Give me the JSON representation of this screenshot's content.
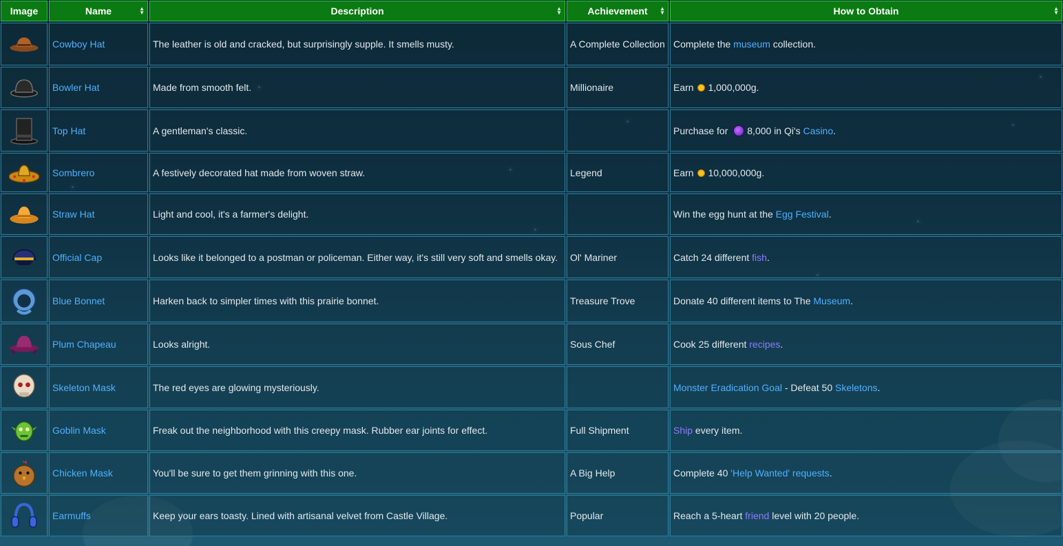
{
  "headers": {
    "image": "Image",
    "name": "Name",
    "description": "Description",
    "achievement": "Achievement",
    "obtain": "How to Obtain"
  },
  "rows": [
    {
      "icon": "cowboy-hat-icon",
      "name": "Cowboy Hat",
      "description": "The leather is old and cracked, but surprisingly supple. It smells musty.",
      "achievement": "A Complete Collection",
      "obtain": [
        {
          "t": "Complete the "
        },
        {
          "link": "museum"
        },
        {
          "t": " collection."
        }
      ]
    },
    {
      "icon": "bowler-hat-icon",
      "name": "Bowler Hat",
      "description": "Made from smooth felt.",
      "achievement": "Millionaire",
      "obtain": [
        {
          "t": "Earn "
        },
        {
          "coin": "gold"
        },
        {
          "t": "1,000,000g."
        }
      ]
    },
    {
      "icon": "top-hat-icon",
      "name": "Top Hat",
      "description": "A gentleman's classic.",
      "achievement": "",
      "obtain": [
        {
          "t": "Purchase for "
        },
        {
          "coin": "qi"
        },
        {
          "t": "8,000 in Qi's "
        },
        {
          "link": "Casino"
        },
        {
          "t": "."
        }
      ]
    },
    {
      "icon": "sombrero-icon",
      "name": "Sombrero",
      "description": "A festively decorated hat made from woven straw.",
      "achievement": "Legend",
      "obtain": [
        {
          "t": "Earn "
        },
        {
          "coin": "gold"
        },
        {
          "t": "10,000,000g."
        }
      ]
    },
    {
      "icon": "straw-hat-icon",
      "name": "Straw Hat",
      "description": "Light and cool, it's a farmer's delight.",
      "achievement": "",
      "obtain": [
        {
          "t": "Win the egg hunt at the "
        },
        {
          "link": "Egg Festival"
        },
        {
          "t": "."
        }
      ]
    },
    {
      "icon": "official-cap-icon",
      "name": "Official Cap",
      "description": "Looks like it belonged to a postman or policeman. Either way, it's still very soft and smells okay.",
      "achievement": "Ol' Mariner",
      "obtain": [
        {
          "t": "Catch 24 different "
        },
        {
          "link": "fish",
          "visited": true
        },
        {
          "t": "."
        }
      ]
    },
    {
      "icon": "blue-bonnet-icon",
      "name": "Blue Bonnet",
      "description": "Harken back to simpler times with this prairie bonnet.",
      "achievement": "Treasure Trove",
      "obtain": [
        {
          "t": "Donate 40 different items to The "
        },
        {
          "link": "Museum"
        },
        {
          "t": "."
        }
      ]
    },
    {
      "icon": "plum-chapeau-icon",
      "name": "Plum Chapeau",
      "description": "Looks alright.",
      "achievement": "Sous Chef",
      "obtain": [
        {
          "t": "Cook 25 different "
        },
        {
          "link": "recipes",
          "visited": true
        },
        {
          "t": "."
        }
      ]
    },
    {
      "icon": "skeleton-mask-icon",
      "name": "Skeleton Mask",
      "description": "The red eyes are glowing mysteriously.",
      "achievement": "",
      "obtain": [
        {
          "link": "Monster Eradication Goal"
        },
        {
          "t": " - Defeat 50 "
        },
        {
          "link": "Skeletons"
        },
        {
          "t": "."
        }
      ]
    },
    {
      "icon": "goblin-mask-icon",
      "name": "Goblin Mask",
      "description": "Freak out the neighborhood with this creepy mask. Rubber ear joints for effect.",
      "achievement": "Full Shipment",
      "obtain": [
        {
          "link": "Ship",
          "visited": true
        },
        {
          "t": " every item."
        }
      ]
    },
    {
      "icon": "chicken-mask-icon",
      "name": "Chicken Mask",
      "description": "You'll be sure to get them grinning with this one.",
      "achievement": "A Big Help",
      "obtain": [
        {
          "t": "Complete 40 "
        },
        {
          "link": "'Help Wanted' requests"
        },
        {
          "t": "."
        }
      ]
    },
    {
      "icon": "earmuffs-icon",
      "name": "Earmuffs",
      "description": "Keep your ears toasty. Lined with artisanal velvet from Castle Village.",
      "achievement": "Popular",
      "obtain": [
        {
          "t": "Reach a 5-heart "
        },
        {
          "link": "friend",
          "visited": true
        },
        {
          "t": " level with 20 people."
        }
      ]
    }
  ]
}
